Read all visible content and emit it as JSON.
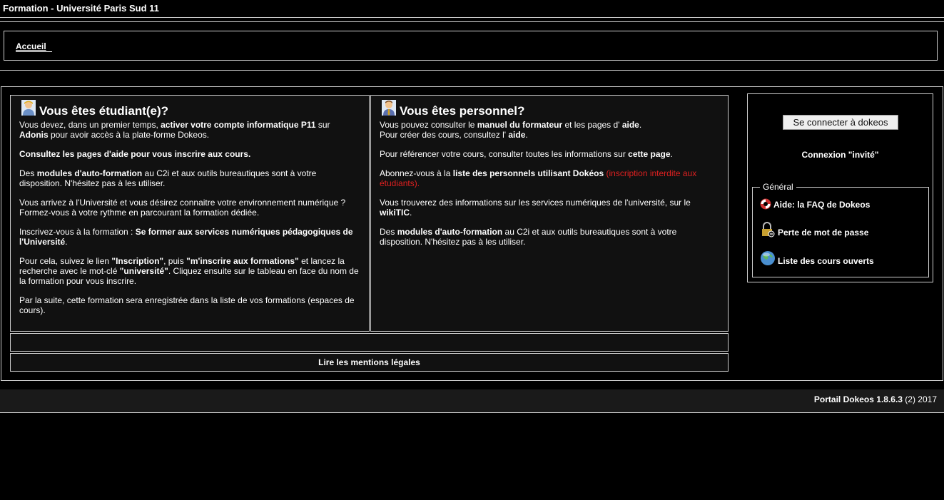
{
  "header": {
    "title": "Formation - Université Paris Sud 11"
  },
  "breadcrumb": {
    "home": "Accueil"
  },
  "student_panel": {
    "heading": "Vous êtes étudiant(e)?",
    "icon": "student-icon",
    "p1": [
      "Vous devez, dans un premier temps, ",
      "activer votre compte informatique P11",
      " sur ",
      "Adonis",
      " pour avoir accès à la plate-forme Dokeos."
    ],
    "p2": [
      "Consultez les pages d'",
      "aide",
      " pour vous ",
      "inscrire aux cours."
    ],
    "p3": [
      "Des ",
      "modules d'auto-formation",
      " au C2i et aux outils bureautiques sont à votre disposition. N'hésitez pas à les utiliser."
    ],
    "p4": "Vous arrivez à l'Université et vous désirez connaitre votre environnement numérique ? Formez-vous à votre rythme en parcourant la formation dédiée.",
    "p5": [
      "Inscrivez-vous à la formation : ",
      "Se former aux services numériques pédagogiques de l'Université",
      "."
    ],
    "p6": [
      "Pour cela, suivez le lien ",
      "\"Inscription\"",
      ", puis ",
      "\"m'inscrire aux formations\"",
      " et lancez la recherche avec le mot-clé ",
      "\"université\"",
      ". Cliquez ensuite sur le tableau en face du nom de la formation pour vous inscrire."
    ],
    "p7": "Par la suite, cette formation sera enregistrée dans la liste de vos formations (espaces de cours)."
  },
  "staff_panel": {
    "heading": "Vous êtes personnel?",
    "icon": "staff-icon",
    "p1": [
      "Vous pouvez consulter le ",
      "manuel du formateur",
      " et les pages d' ",
      "aide",
      ".",
      "Pour créer des cours, consultez l' ",
      "aide",
      "."
    ],
    "p2": [
      "Pour référencer votre cours, consulter toutes les informations sur ",
      "cette page",
      "."
    ],
    "p3": [
      "Abonnez-vous à la ",
      "liste des personnels utilisant Dokéos",
      " ",
      "(inscription interdite aux étudiants)",
      "."
    ],
    "p4": [
      "Vous trouverez des informations sur les services numériques de l'université, sur le ",
      "wikiTIC",
      "."
    ],
    "p5": [
      "Des ",
      "modules d'auto-formation",
      " au C2i et aux outils bureautiques sont à votre disposition. N'hésitez pas à les utiliser."
    ]
  },
  "legal": {
    "label": "Lire les mentions légales"
  },
  "sidebar": {
    "login_button": "Se connecter à dokeos",
    "guest_login": "Connexion \"invité\"",
    "general_legend": "Général",
    "items": [
      {
        "label": "Aide: la FAQ de Dokeos",
        "icon": "lifebuoy-icon"
      },
      {
        "label": "Perte de mot de passe",
        "icon": "padlock-icon"
      },
      {
        "label": "Liste des cours ouverts",
        "icon": "globe-icon"
      }
    ]
  },
  "footer": {
    "portal": "Portail Dokeos 1.8.6.3",
    "suffix": " (2) 2017"
  }
}
